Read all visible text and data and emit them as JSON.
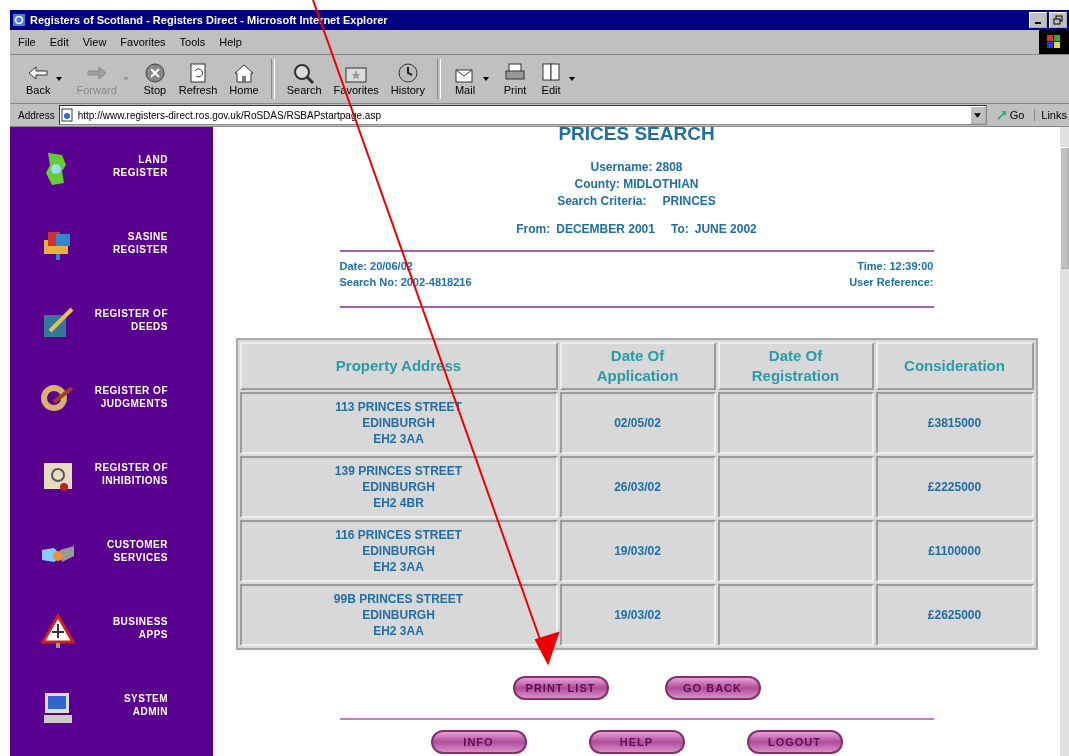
{
  "window": {
    "title": "Registers of Scotland - Registers Direct - Microsoft Internet Explorer"
  },
  "menu": [
    "File",
    "Edit",
    "View",
    "Favorites",
    "Tools",
    "Help"
  ],
  "toolbar": [
    {
      "label": "Back",
      "disabled": false,
      "dropdown": true
    },
    {
      "label": "Forward",
      "disabled": true,
      "dropdown": true
    },
    {
      "label": "Stop",
      "disabled": false,
      "dropdown": false
    },
    {
      "label": "Refresh",
      "disabled": false,
      "dropdown": false
    },
    {
      "label": "Home",
      "disabled": false,
      "dropdown": false
    },
    {
      "label": "Search",
      "disabled": false,
      "dropdown": false
    },
    {
      "label": "Favorites",
      "disabled": false,
      "dropdown": false
    },
    {
      "label": "History",
      "disabled": false,
      "dropdown": false
    },
    {
      "label": "Mail",
      "disabled": false,
      "dropdown": true
    },
    {
      "label": "Print",
      "disabled": false,
      "dropdown": false
    },
    {
      "label": "Edit",
      "disabled": false,
      "dropdown": true
    }
  ],
  "address": {
    "label": "Address",
    "url": "http://www.registers-direct.ros.gov.uk/RoSDAS/RSBAPstartpage.asp",
    "go": "Go",
    "links": "Links"
  },
  "sidebar": {
    "items": [
      {
        "lines": [
          "LAND",
          "REGISTER"
        ]
      },
      {
        "lines": [
          "SASINE",
          "REGISTER"
        ]
      },
      {
        "lines": [
          "REGISTER OF",
          "DEEDS"
        ]
      },
      {
        "lines": [
          "REGISTER OF",
          "JUDGMENTS"
        ]
      },
      {
        "lines": [
          "REGISTER OF",
          "INHIBITIONS"
        ]
      },
      {
        "lines": [
          "CUSTOMER",
          "SERVICES"
        ]
      },
      {
        "lines": [
          "BUSINESS",
          "APPS"
        ]
      },
      {
        "lines": [
          "SYSTEM",
          "ADMIN"
        ]
      }
    ]
  },
  "page": {
    "title": "PRICES SEARCH",
    "username": "Username: 2808",
    "county": "County: MIDLOTHIAN",
    "criteria": {
      "label": "Search Criteria:",
      "value": "PRINCES"
    },
    "range": {
      "from_label": "From:",
      "from": "DECEMBER 2001",
      "to_label": "To:",
      "to": "JUNE 2002"
    },
    "date": "Date: 20/06/02",
    "time": "Time: 12:39:00",
    "search_no": "Search No: 2002-4818216",
    "user_reference": "User Reference:"
  },
  "table": {
    "columns": [
      [
        "Property Address"
      ],
      [
        "Date Of",
        "Application"
      ],
      [
        "Date Of",
        "Registration"
      ],
      [
        "Consideration"
      ]
    ],
    "rows": [
      {
        "address": [
          "113 PRINCES STREET",
          "EDINBURGH",
          "EH2 3AA"
        ],
        "date_of_application": "02/05/02",
        "consideration": "£3815000"
      },
      {
        "address": [
          "139 PRINCES STREET",
          "EDINBURGH",
          "EH2 4BR"
        ],
        "date_of_application": "26/03/02",
        "consideration": "£2225000"
      },
      {
        "address": [
          "116 PRINCES STREET",
          "EDINBURGH",
          "EH2 3AA"
        ],
        "date_of_application": "19/03/02",
        "consideration": "£1100000"
      },
      {
        "address": [
          "99B   PRINCES STREET",
          "EDINBURGH",
          "EH2 3AA"
        ],
        "date_of_application": "19/03/02",
        "consideration": "£2625000"
      }
    ]
  },
  "actions": [
    "PRINT LIST",
    "GO BACK"
  ],
  "footer_buttons": [
    "INFO",
    "HELP",
    "LOGOUT"
  ]
}
